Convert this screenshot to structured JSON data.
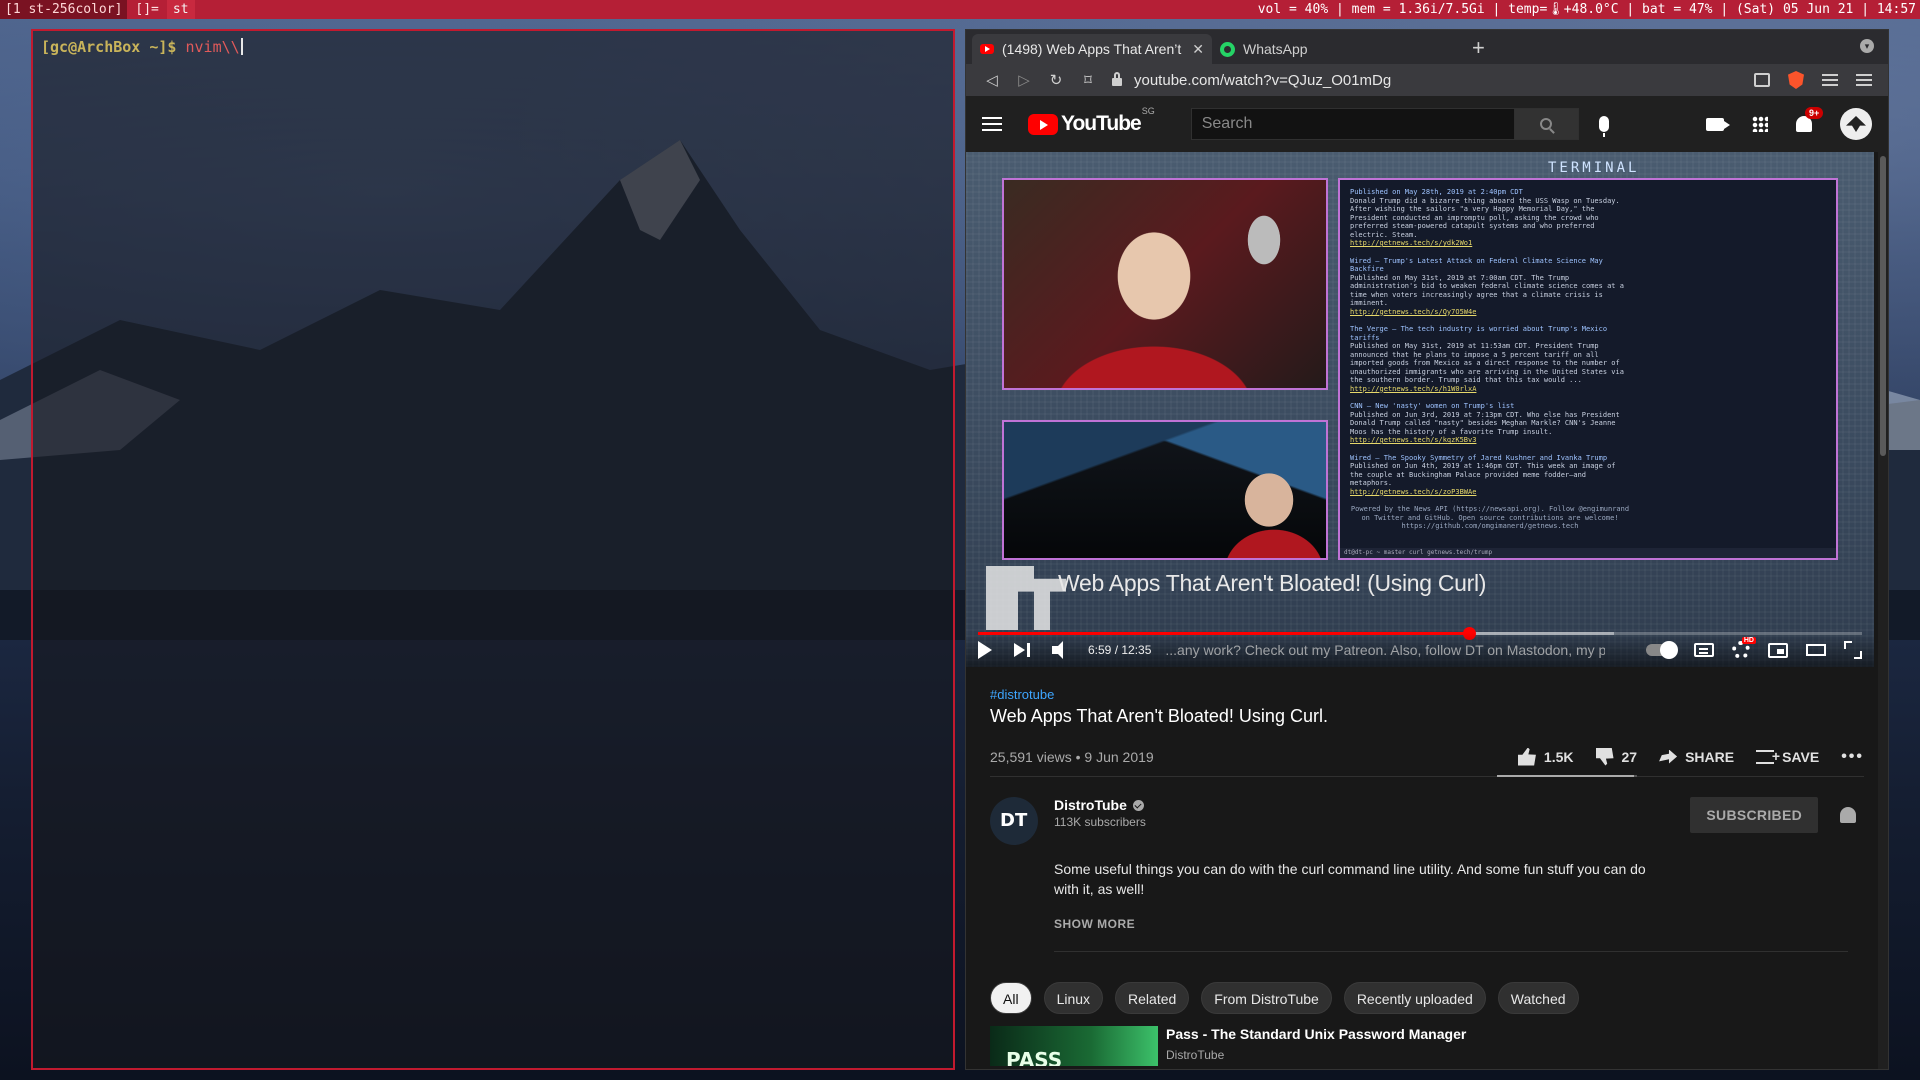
{
  "statusbar": {
    "workspace": "[1 st-256color]",
    "layout": "[]=",
    "window_title": "st",
    "status": "vol = 40%  |  mem = 1.36i/7.5Gi  |  temp=🌡+48.0°C  |  bat = 47%  |  (Sat) 05 Jun 21  |  14:57"
  },
  "terminal": {
    "prompt": "[gc@ArchBox ~]$ ",
    "command": "nvim\\\\"
  },
  "browser": {
    "tabs": [
      {
        "label": "(1498) Web Apps That Aren’t",
        "icon": "youtube-icon"
      },
      {
        "label": "WhatsApp",
        "icon": "whatsapp-icon"
      }
    ],
    "url": "youtube.com/watch?v=QJuz_O01mDg"
  },
  "youtube": {
    "logo_text": "YouTube",
    "region": "SG",
    "search_placeholder": "Search",
    "notification_badge": "9+",
    "player": {
      "studio_label": "TERMINAL",
      "overlay_title": "Web Apps That Aren't Bloated!  (Using Curl)",
      "caption_scroll": "...any work? Check out my Patreon.  Also, follow DT on Mastodon, my preferred soci...",
      "time": "6:59 / 12:35",
      "progress": 0.555,
      "buffered": 0.72,
      "hd_badge": "HD",
      "news": [
        {
          "head": "Published on May 28th, 2019 at 2:40pm CDT",
          "body": "Donald Trump did a bizarre thing aboard the USS Wasp on Tuesday. After wishing the sailors \"a very Happy Memorial Day,\" the President conducted an impromptu poll, asking the crowd who preferred steam-powered catapult systems and who preferred electric. Steam.",
          "link": "http://getnews.tech/s/ydk2Wo1"
        },
        {
          "head": "Wired – Trump's Latest Attack on Federal Climate Science May Backfire",
          "body": "Published on May 31st, 2019 at 7:00am CDT. The Trump administration's bid to weaken federal climate science comes at a time when voters increasingly agree that a climate crisis is imminent.",
          "link": "http://getnews.tech/s/Qy7O5W4e"
        },
        {
          "head": "The Verge – The tech industry is worried about Trump's Mexico tariffs",
          "body": "Published on May 31st, 2019 at 11:53am CDT. President Trump announced that he plans to impose a 5 percent tariff on all imported goods from Mexico as a direct response to the number of unauthorized immigrants who are arriving in the United States via the southern border. Trump said that this tax would ...",
          "link": "http://getnews.tech/s/h1W0rlxA"
        },
        {
          "head": "CNN – New 'nasty' women on Trump's list",
          "body": "Published on Jun 3rd, 2019 at 7:13pm CDT. Who else has President Donald Trump called \"nasty\" besides Meghan Markle? CNN's Jeanne Moos has the history of a favorite Trump insult.",
          "link": "http://getnews.tech/s/kqzK5Bv3"
        },
        {
          "head": "Wired – The Spooky Symmetry of Jared Kushner and Ivanka Trump",
          "body": "Published on Jun 4th, 2019 at 1:46pm CDT. This week an image of the couple at Buckingham Palace provided meme fodder—and metaphors.",
          "link": "http://getnews.tech/s/zoP3BWAe"
        }
      ],
      "news_footer": "Powered by the News API (https://newsapi.org). Follow @engimunrand on Twitter and GitHub. Open source contributions are welcome! https://github.com/omgimanerd/getnews.tech",
      "term_statusline": "dt@dt-pc  ~  master  curl getnews.tech/trump"
    },
    "video": {
      "hashtag": "#distrotube",
      "title": "Web Apps That Aren't Bloated! Using Curl.",
      "views": "25,591 views • 9 Jun 2019",
      "likes": "1.5K",
      "dislikes": "27",
      "like_ratio": 0.98,
      "share_label": "SHARE",
      "save_label": "SAVE"
    },
    "channel": {
      "name": "DistroTube",
      "subscribers": "113K subscribers",
      "subscribe_label": "SUBSCRIBED",
      "description": "Some useful things you can do with the curl command line utility.  And some fun stuff you can do with it, as well!",
      "show_more": "SHOW MORE"
    },
    "chips": [
      "All",
      "Linux",
      "Related",
      "From DistroTube",
      "Recently uploaded",
      "Watched"
    ],
    "recommendation": {
      "title": "Pass - The Standard Unix Password Manager",
      "channel": "DistroTube",
      "thumb_text": "PASS"
    }
  }
}
